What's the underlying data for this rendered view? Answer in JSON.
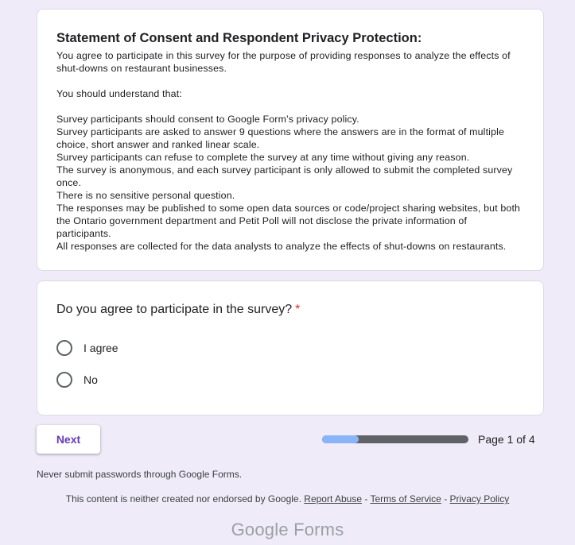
{
  "description": {
    "title": "Statement of Consent and Respondent Privacy Protection:",
    "lines": [
      "You agree to participate in this survey for the purpose of providing responses to analyze the effects of shut-downs on restaurant businesses.",
      "",
      "You should understand that:",
      "",
      "Survey participants should consent to Google Form’s privacy policy.",
      "Survey participants are asked to answer 9 questions where the answers are in the format of multiple choice, short answer and ranked linear scale.",
      "Survey participants can refuse to complete the survey at any time without giving any reason.",
      "The survey is anonymous, and each survey participant is only allowed to submit the completed survey once.",
      "There is no sensitive personal question.",
      "The responses may be published to some open data sources or code/project sharing websites, but both the Ontario government department and Petit Poll will not disclose the private information of participants.",
      "All responses are collected for the data analysts to analyze the effects of shut-downs on restaurants."
    ]
  },
  "question": {
    "title": "Do you agree to participate in the survey?",
    "required_mark": "*",
    "options": [
      "I agree",
      "No"
    ]
  },
  "navigation": {
    "next_label": "Next",
    "progress_fraction": 0.25,
    "page_indicator": "Page 1 of 4"
  },
  "footer": {
    "warning": "Never submit passwords through Google Forms.",
    "disclaimer": "This content is neither created nor endorsed by Google.",
    "links": [
      "Report Abuse",
      "Terms of Service",
      "Privacy Policy"
    ],
    "separator": "-",
    "logo": "Google Forms"
  },
  "colors": {
    "background": "#f0ebf8",
    "accent": "#673ab7",
    "progress_fill": "#8ab4f8",
    "progress_track": "#5f6368",
    "required": "#d93025"
  }
}
